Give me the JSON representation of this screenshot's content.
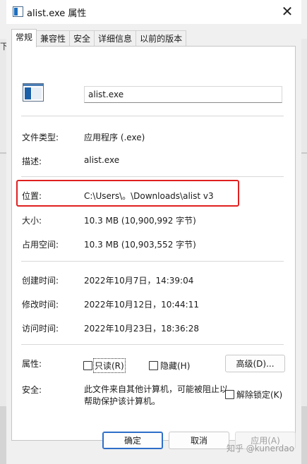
{
  "window": {
    "title": "alist.exe 属性",
    "close_glyph": "✕"
  },
  "tabs": [
    {
      "label": "常规",
      "active": true
    },
    {
      "label": "兼容性",
      "active": false
    },
    {
      "label": "安全",
      "active": false
    },
    {
      "label": "详细信息",
      "active": false
    },
    {
      "label": "以前的版本",
      "active": false
    }
  ],
  "general": {
    "file_name": "alist.exe",
    "file_type_label": "文件类型:",
    "file_type_value": "应用程序 (.exe)",
    "description_label": "描述:",
    "description_value": "alist.exe",
    "location_label": "位置:",
    "location_value": "C:\\Users\\。\\Downloads\\alist v3",
    "size_label": "大小:",
    "size_value": "10.3 MB (10,900,992 字节)",
    "size_on_disk_label": "占用空间:",
    "size_on_disk_value": "10.3 MB (10,903,552 字节)",
    "created_label": "创建时间:",
    "created_value": "2022年10月7日，14:39:04",
    "modified_label": "修改时间:",
    "modified_value": "2022年10月12日，10:44:11",
    "accessed_label": "访问时间:",
    "accessed_value": "2022年10月23日，18:36:28",
    "attributes_label": "属性:",
    "readonly_label": "只读(R)",
    "hidden_label": "隐藏(H)",
    "advanced_button": "高级(D)...",
    "security_label": "安全:",
    "security_text": "此文件来自其他计算机，可能被阻止以帮助保护该计算机。",
    "unblock_label": "解除锁定(K)"
  },
  "footer": {
    "ok": "确定",
    "cancel": "取消",
    "apply": "应用(A)"
  },
  "watermark": "知乎 @kunerdao",
  "colors": {
    "highlight": "#e02020",
    "primary_border": "#2d6ec9"
  }
}
